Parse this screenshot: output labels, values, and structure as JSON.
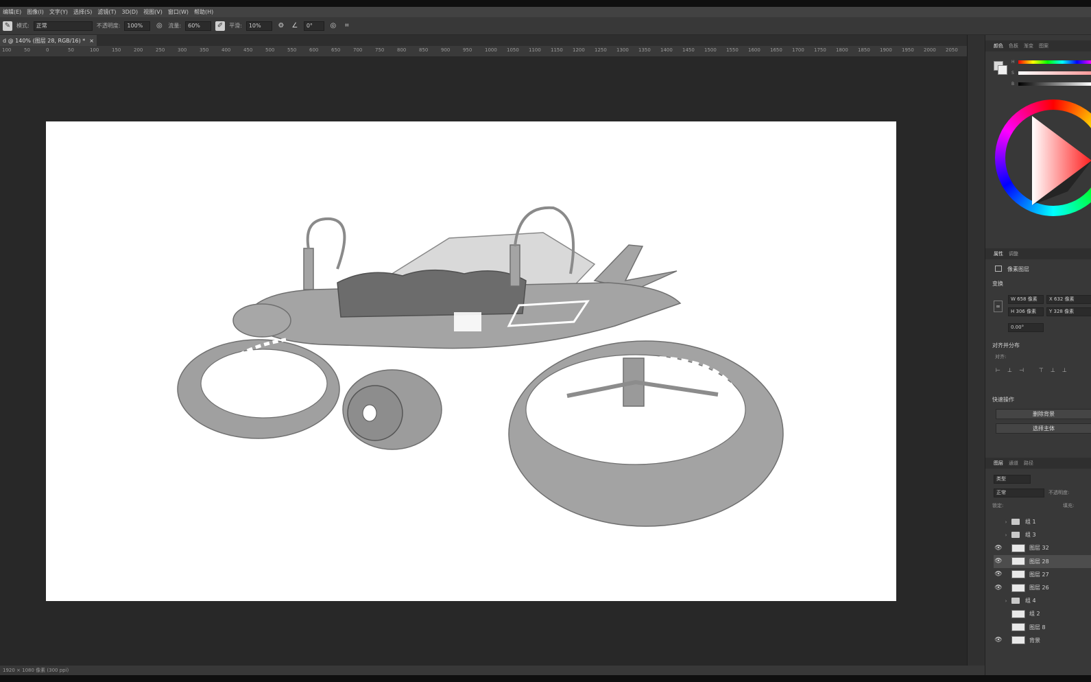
{
  "menu": [
    "编辑(E)",
    "图像(I)",
    "文字(Y)",
    "选择(S)",
    "滤镜(T)",
    "3D(D)",
    "视图(V)",
    "窗口(W)",
    "帮助(H)"
  ],
  "options": {
    "mode_label": "模式:",
    "mode_value": "正常",
    "opacity_label": "不透明度:",
    "opacity_value": "100%",
    "flow_label": "流量:",
    "flow_value": "60%",
    "smoothing_label": "平滑:",
    "smoothing_value": "10%",
    "angle_value": "0°"
  },
  "document_tab": {
    "title": "d @ 140% (图层 28, RGB/16) *",
    "close": "×"
  },
  "ruler_marks": [
    "100",
    "50",
    "0",
    "50",
    "100",
    "150",
    "200",
    "250",
    "300",
    "350",
    "400",
    "450",
    "500",
    "550",
    "600",
    "650",
    "700",
    "750",
    "800",
    "850",
    "900",
    "950",
    "1000",
    "1050",
    "1100",
    "1150",
    "1200",
    "1250",
    "1300",
    "1350",
    "1400",
    "1450",
    "1500",
    "1550",
    "1600",
    "1650",
    "1700",
    "1750",
    "1800",
    "1850",
    "1900",
    "1950",
    "2000",
    "2050"
  ],
  "status_text": "1920 × 1080 像素 (300 ppi)",
  "color_panel": {
    "tabs": [
      "颜色",
      "色板",
      "渐变",
      "图案"
    ],
    "sliders": [
      "H",
      "S",
      "B"
    ]
  },
  "properties_panel": {
    "tabs": [
      "属性",
      "调整"
    ],
    "layer_type": "像素图层",
    "transform_title": "变换",
    "w": "W 658 像素",
    "x": "X 632 像素",
    "h": "H 306 像素",
    "y": "Y 328 像素",
    "angle": "0.00°",
    "align_title": "对齐并分布",
    "align_label": "对齐:",
    "quick_actions_title": "快速操作",
    "remove_bg_button": "删除背景",
    "select_subject_button": "选择主体"
  },
  "layers_panel": {
    "tabs": [
      "图层",
      "通道",
      "路径"
    ],
    "filter_label": "类型",
    "blend_mode": "正常",
    "opacity_label": "不透明度:",
    "lock_label": "锁定:",
    "fill_label": "填充:",
    "layers": [
      {
        "name": "组 1",
        "visible": false,
        "kind": "folder",
        "selected": false
      },
      {
        "name": "组 3",
        "visible": false,
        "kind": "folder",
        "selected": false
      },
      {
        "name": "图层 32",
        "visible": true,
        "kind": "layer",
        "selected": false
      },
      {
        "name": "图层 28",
        "visible": true,
        "kind": "layer",
        "selected": true
      },
      {
        "name": "图层 27",
        "visible": true,
        "kind": "layer",
        "selected": false
      },
      {
        "name": "图层 26",
        "visible": true,
        "kind": "layer",
        "selected": false
      },
      {
        "name": "组 4",
        "visible": false,
        "kind": "folder",
        "selected": false
      },
      {
        "name": "组 2",
        "visible": false,
        "kind": "layer",
        "selected": false
      },
      {
        "name": "图层 8",
        "visible": false,
        "kind": "layer",
        "selected": false
      },
      {
        "name": "背景",
        "visible": true,
        "kind": "layer",
        "selected": false
      }
    ]
  },
  "colors": {
    "canvas_bg": "#ffffff",
    "workspace_bg": "#282828",
    "panel_bg": "#383838",
    "sketch_gray": "#a3a3a3",
    "sketch_line": "#6f6f6f"
  }
}
